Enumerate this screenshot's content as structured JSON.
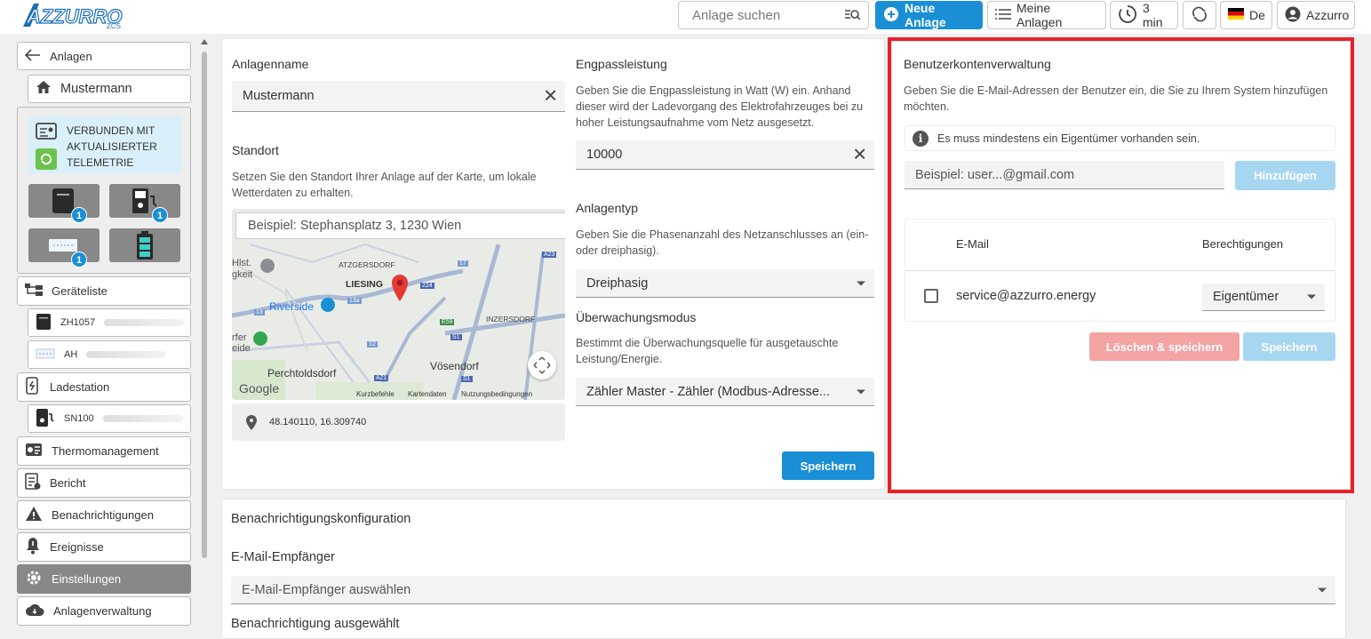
{
  "header": {
    "logo_text": "AZZURRO",
    "logo_sub": "ZCS",
    "search_placeholder": "Anlage suchen",
    "new_plant_label": "Neue Anlage",
    "my_plants_label": "Meine Anlagen",
    "refresh_interval": "3 min",
    "language": "De",
    "user": "Azzurro"
  },
  "sidebar": {
    "back_label": "Anlagen",
    "plant_name": "Mustermann",
    "status": {
      "line1": "Verbunden mit",
      "line2": "aktualisierter",
      "line3": "Telemetrie"
    },
    "device_badges": [
      "1",
      "1",
      "1"
    ],
    "items": [
      {
        "label": "Geräteliste"
      },
      {
        "label": "ZH1057"
      },
      {
        "label": "AH"
      },
      {
        "label": "Ladestation"
      },
      {
        "label": "SN100"
      },
      {
        "label": "Thermomanagement"
      },
      {
        "label": "Bericht"
      },
      {
        "label": "Benachrichtigungen"
      },
      {
        "label": "Ereignisse"
      },
      {
        "label": "Einstellungen"
      },
      {
        "label": "Anlagenverwaltung"
      }
    ]
  },
  "plant_settings": {
    "name_label": "Anlagenname",
    "name_value": "Mustermann",
    "location_label": "Standort",
    "location_desc": "Setzen Sie den Standort Ihrer Anlage auf der Karte, um lokale Wetterdaten zu erhalten.",
    "map_search_placeholder": "Beispiel: Stephansplatz 3, 1230 Wien",
    "map_labels": [
      "ATZGERSDORF",
      "LIESING",
      "Riverside",
      "INZERSDORF",
      "Perchtoldsdorf",
      "Vösendorf",
      "Hlst.",
      "gkeit",
      "rfer",
      "eide"
    ],
    "map_footer": [
      "Google",
      "Kurzbefehle",
      "Kartendaten",
      "Nutzungsbedingungen"
    ],
    "map_road_labels": [
      "A23",
      "17",
      "224",
      "13a",
      "13",
      "E59",
      "S1",
      "12",
      "A21",
      "S1"
    ],
    "coordinates": "48.140110, 16.309740",
    "bottleneck_label": "Engpassleistung",
    "bottleneck_desc": "Geben Sie die Engpassleistung in Watt (W) ein. Anhand dieser wird der Ladevorgang des Elektrofahrzeuges bei zu hoher Leistungsaufnahme vom Netz ausgesetzt.",
    "bottleneck_value": "10000",
    "type_label": "Anlagentyp",
    "type_desc": "Geben Sie die Phasenanzahl des Netzanschlusses an (ein- oder dreiphasig).",
    "type_value": "Dreiphasig",
    "monitoring_label": "Überwachungsmodus",
    "monitoring_desc": "Bestimmt die Überwachungsquelle für ausgetauschte Leistung/Energie.",
    "monitoring_value": "Zähler Master - Zähler (Modbus-Adresse...",
    "save_label": "Speichern"
  },
  "accounts": {
    "title": "Benutzerkontenverwaltung",
    "desc": "Geben Sie die E-Mail-Adressen der Benutzer ein, die Sie zu Ihrem System hinzufügen möchten.",
    "info": "Es muss mindestens ein Eigentümer vorhanden sein.",
    "email_placeholder": "Beispiel: user...@gmail.com",
    "add_label": "Hinzufügen",
    "col_email": "E-Mail",
    "col_permissions": "Berechtigungen",
    "rows": [
      {
        "email": "service@azzurro.energy",
        "permission": "Eigentümer"
      }
    ],
    "delete_save_label": "Löschen & speichern",
    "save_label": "Speichern"
  },
  "notifications": {
    "title": "Benachrichtigungskonfiguration",
    "recipients_label": "E-Mail-Empfänger",
    "recipients_placeholder": "E-Mail-Empfänger auswählen",
    "selected_label": "Benachrichtigung ausgewählt"
  }
}
